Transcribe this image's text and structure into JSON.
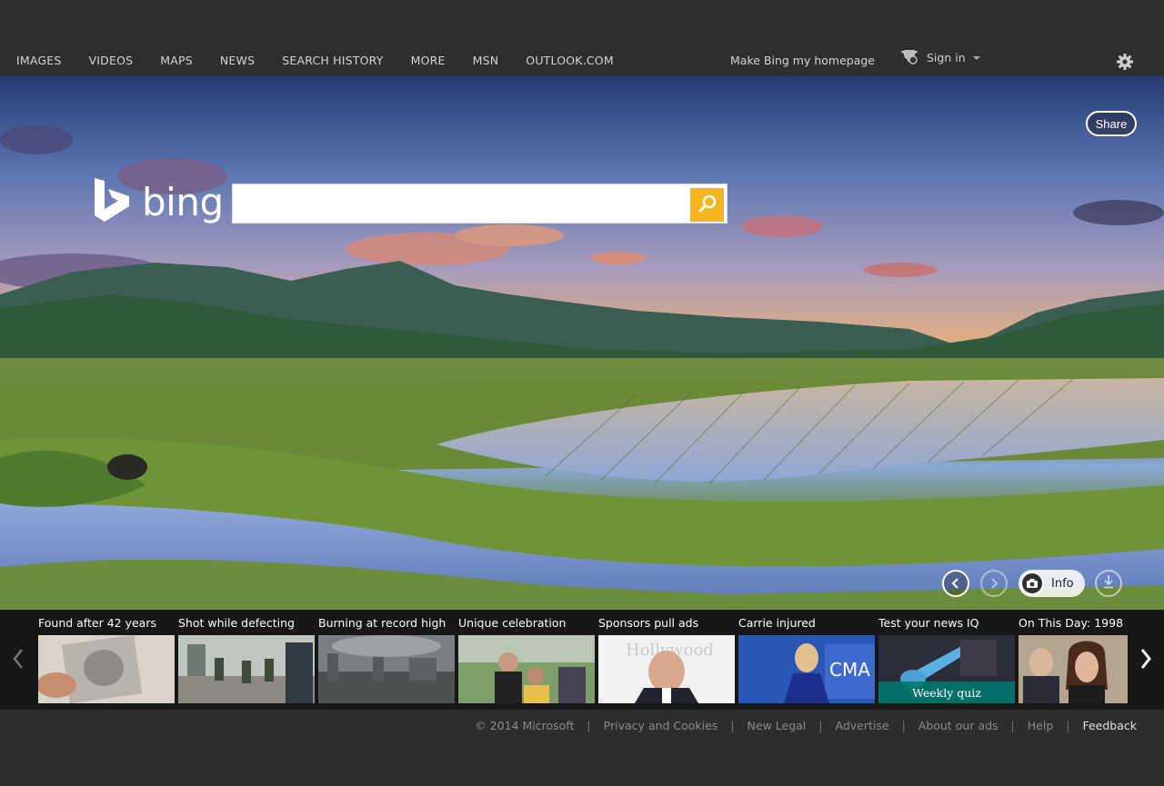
{
  "nav": {
    "items": [
      "IMAGES",
      "VIDEOS",
      "MAPS",
      "NEWS",
      "SEARCH HISTORY",
      "MORE",
      "MSN",
      "OUTLOOK.COM"
    ],
    "homepage": "Make Bing my homepage",
    "signin": "Sign in"
  },
  "hero": {
    "share": "Share",
    "logo_word": "bing",
    "search_placeholder": "",
    "info_label": "Info"
  },
  "carousel": {
    "cards": [
      {
        "title": "Found after 42 years"
      },
      {
        "title": "Shot while defecting"
      },
      {
        "title": "Burning at record high"
      },
      {
        "title": "Unique celebration"
      },
      {
        "title": "Sponsors pull ads"
      },
      {
        "title": "Carrie injured"
      },
      {
        "title": "Test your news IQ",
        "overlay": "Weekly quiz"
      },
      {
        "title": "On This Day: 1998"
      }
    ]
  },
  "footer": {
    "copyright": "© 2014 Microsoft",
    "links": [
      "Privacy and Cookies",
      "New Legal",
      "Advertise",
      "About our ads",
      "Help"
    ],
    "feedback": "Feedback"
  },
  "colors": {
    "search_button": "#f5b521",
    "topbar": "#2e2e2e",
    "quiz_overlay": "#00786e"
  },
  "icons": [
    "gear-icon",
    "trophy-icon",
    "search-icon",
    "chevron-left-icon",
    "chevron-right-icon",
    "camera-icon",
    "download-icon",
    "bing-logo-icon"
  ]
}
